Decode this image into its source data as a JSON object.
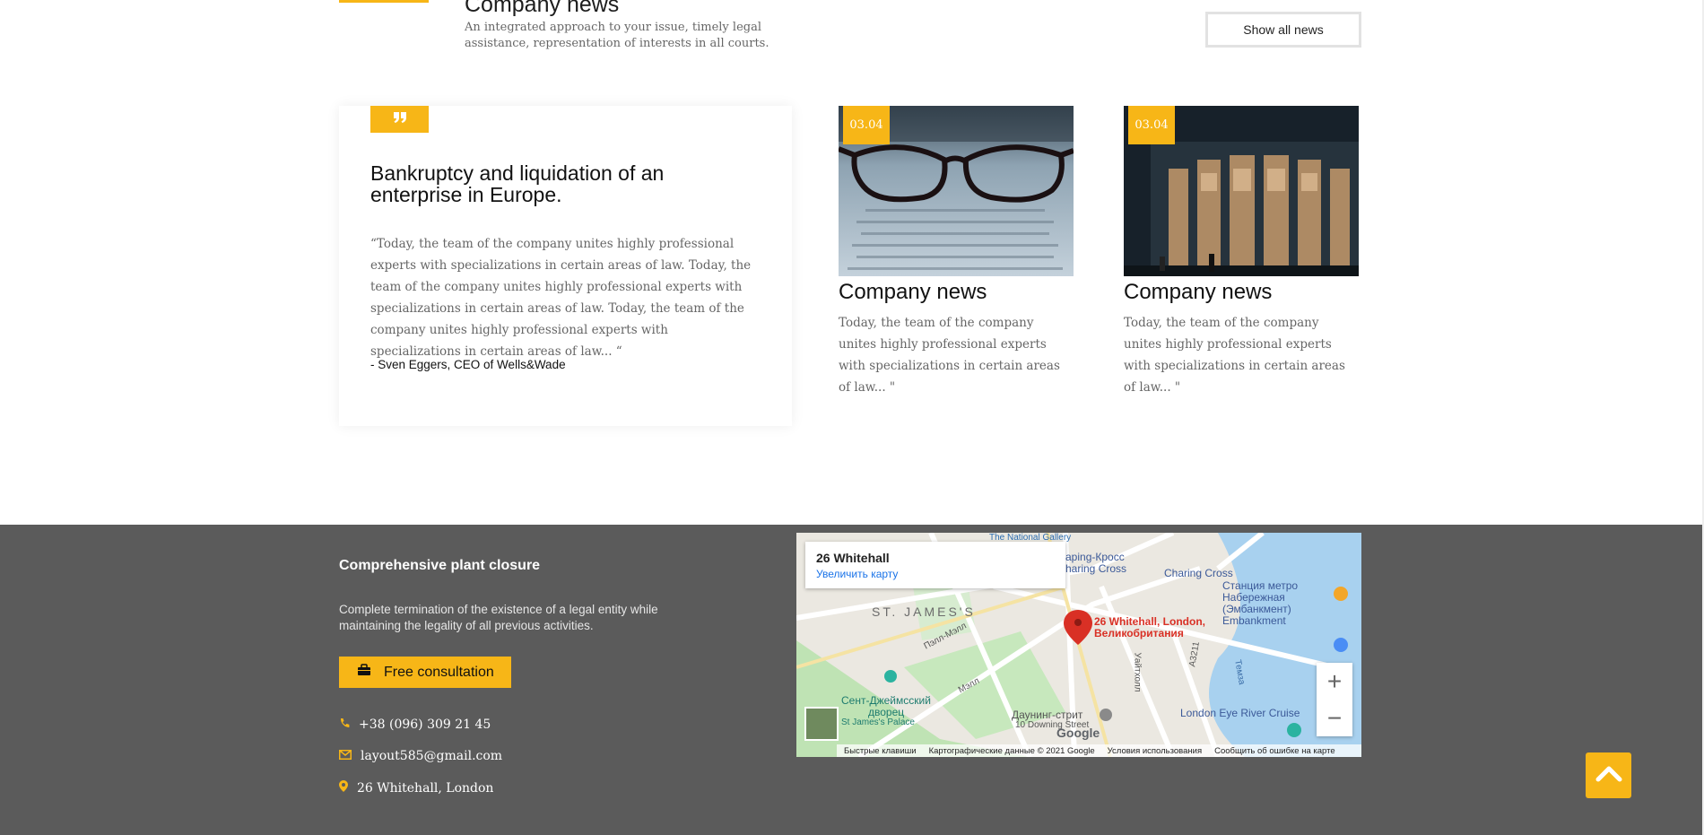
{
  "header": {
    "title": "Company news",
    "subtitle": "An integrated approach to your issue, timely legal assistance, representation of interests in all courts.",
    "show_all_label": "Show all news"
  },
  "quote": {
    "icon": "quote-icon",
    "title": "Bankruptcy and liquidation of an enterprise in Europe.",
    "text": "“Today, the team of the company unites highly professional experts with specializations in certain areas of law. Today, the team of the company unites highly professional experts with specializations in certain areas of law. Today, the team of the company unites highly professional experts with specializations in certain areas of law... “",
    "author": "- Sven Eggers, CEO of Wells&Wade"
  },
  "news": [
    {
      "date": "03.04",
      "title": "Company news",
      "text": "Today, the team of the company unites highly professional experts with specializations in certain areas of law... \"",
      "image": "glasses-on-document"
    },
    {
      "date": "03.04",
      "title": "Company news",
      "text": "Today, the team of the company unites highly professional experts with specializations in certain areas of law... \"",
      "image": "building-at-night"
    }
  ],
  "footer": {
    "heading": "Comprehensive plant closure",
    "description": "Complete termination of the existence of a legal entity while maintaining the legality of all previous activities.",
    "consult_label": "Free consultation",
    "phone": "+38 (096) 309 21 45",
    "email": "layout585@gmail.com",
    "address": "26 Whitehall, London"
  },
  "map": {
    "info_title": "26 Whitehall",
    "enlarge_label": "Увеличить карту",
    "pin_label_line1": "26 Whitehall, London,",
    "pin_label_line2": "Великобритания",
    "labels": {
      "national_gallery": "The National Gallery",
      "charing_cross_ru_1": "арing-Кросс",
      "charing_cross_ru_2": "haring Cross",
      "charing_cross": "Charing Cross",
      "station_1": "Станция метро",
      "station_2": "Набережная",
      "station_3": "(Эмбанкмент)",
      "station_4": "Embankment",
      "st_james": "ST. JAMES'S",
      "pall_mall": "Пэлл-Мэлл",
      "mall": "Мэлл",
      "palace_1": "Сент-Джеймсский",
      "palace_2": "дворец",
      "palace_3": "St James's Palace",
      "downing_1": "Даунинг-стрит",
      "downing_2": "10 Downing Street",
      "whitehall_street": "Уайтхолл",
      "thames": "Темза",
      "road": "A3211",
      "london_eye": "London Eye River Cruise"
    },
    "footer_items": [
      "Быстрые клавиши",
      "Картографические данные © 2021 Google",
      "Условия использования",
      "Сообщить об ошибке на карте"
    ],
    "google_logo": "Google",
    "zoom_in": "+",
    "zoom_out": "−"
  },
  "colors": {
    "accent": "#f7b617",
    "footer_bg": "#5b5b5b"
  }
}
